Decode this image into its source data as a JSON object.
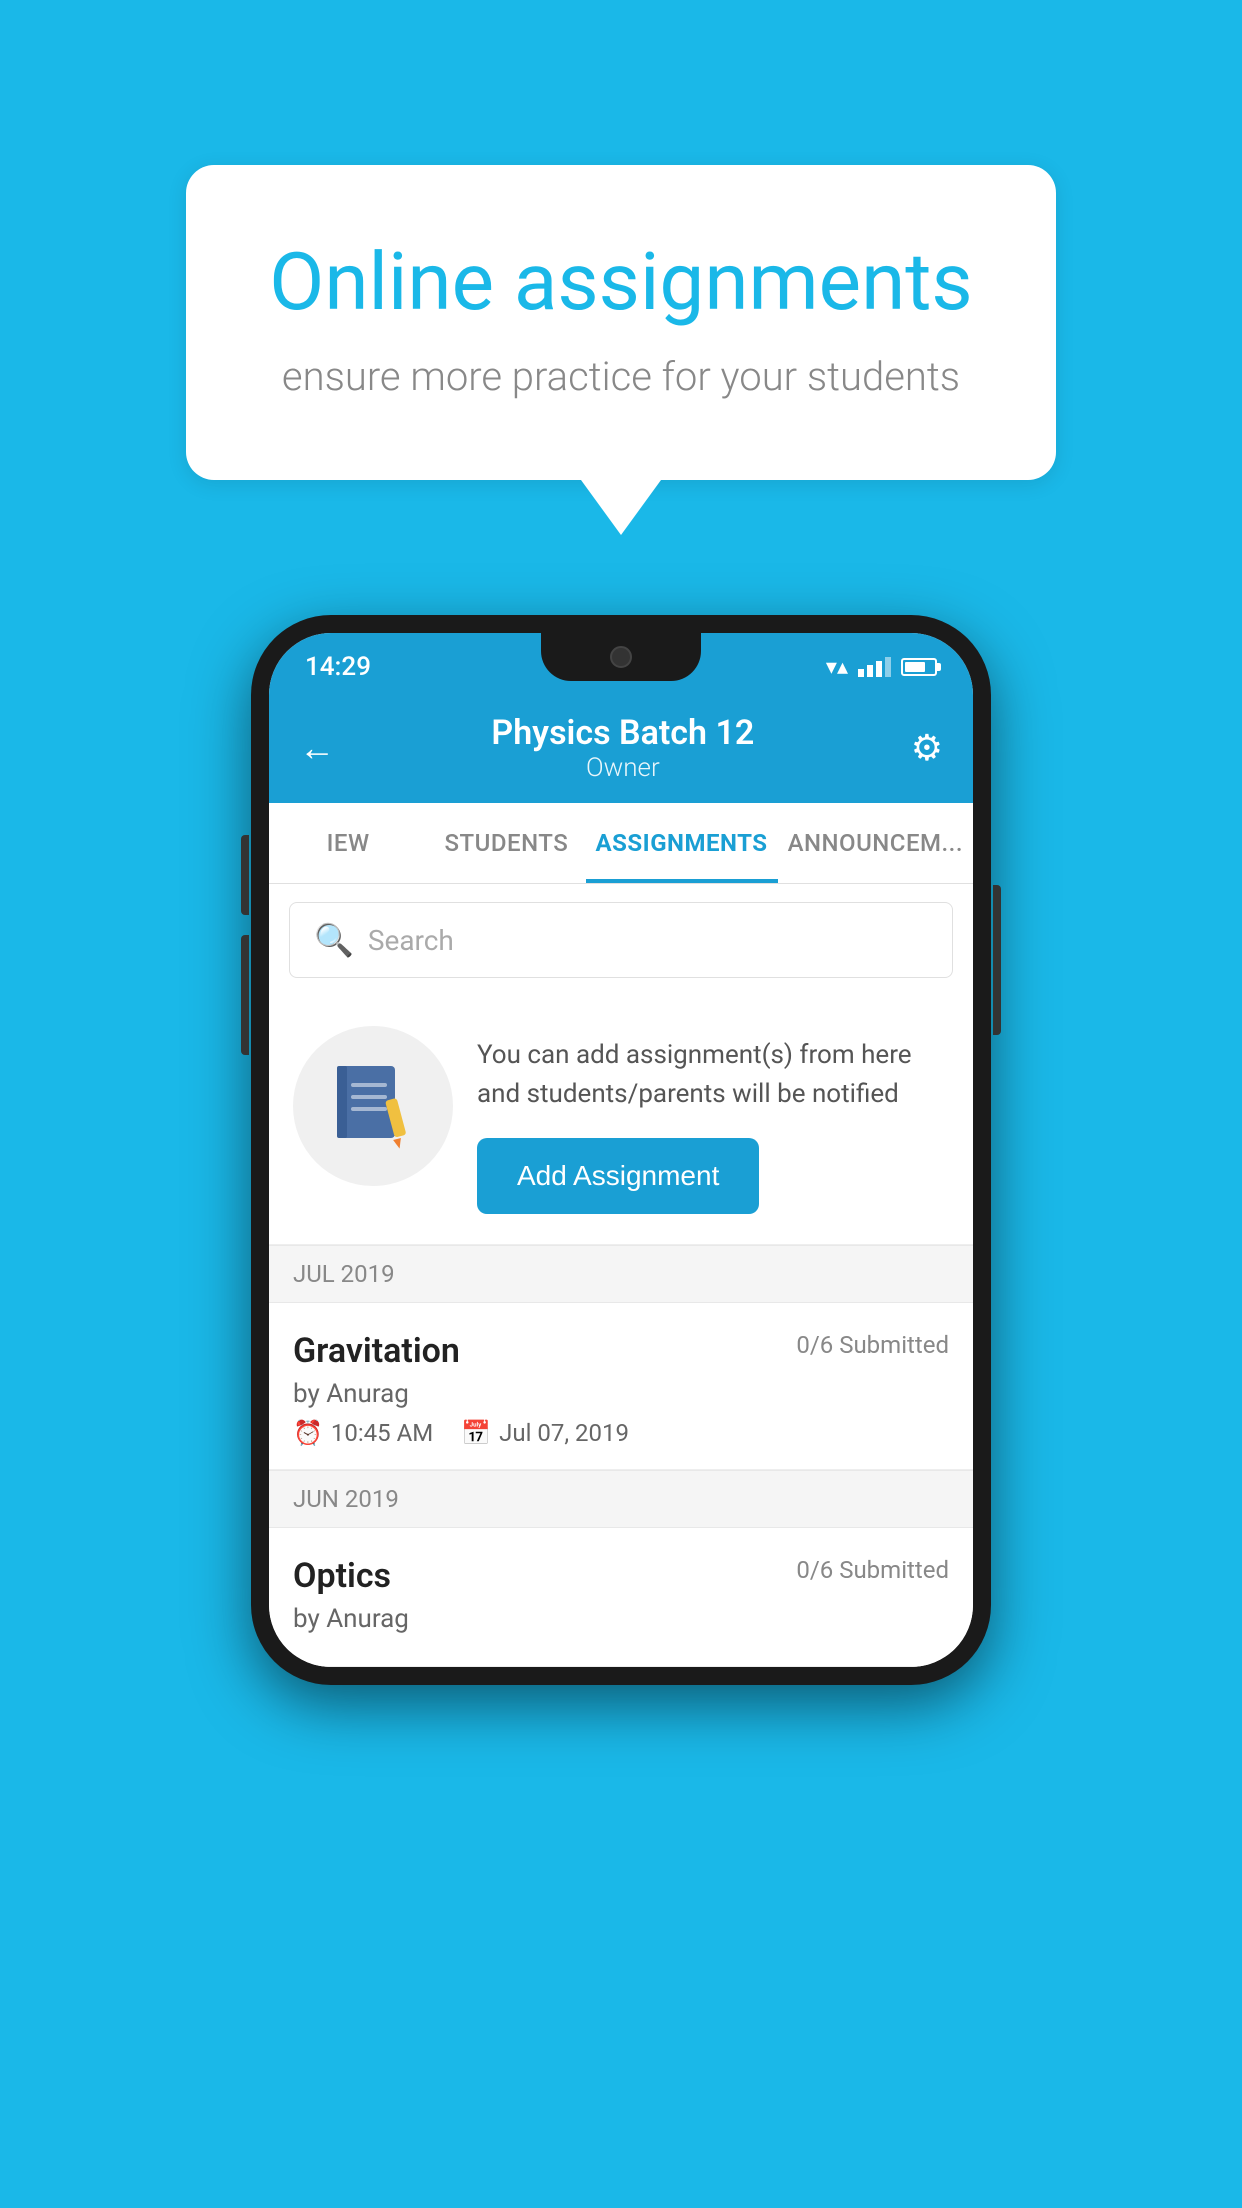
{
  "background_color": "#1ab8e8",
  "speech_bubble": {
    "title": "Online assignments",
    "subtitle": "ensure more practice for your students"
  },
  "phone": {
    "status_bar": {
      "time": "14:29"
    },
    "header": {
      "title": "Physics Batch 12",
      "subtitle": "Owner",
      "back_label": "←",
      "settings_label": "⚙"
    },
    "tabs": [
      {
        "label": "IEW",
        "active": false
      },
      {
        "label": "STUDENTS",
        "active": false
      },
      {
        "label": "ASSIGNMENTS",
        "active": true
      },
      {
        "label": "ANNOUNCEM...",
        "active": false
      }
    ],
    "search": {
      "placeholder": "Search"
    },
    "info_card": {
      "description": "You can add assignment(s) from here and students/parents will be notified",
      "add_button_label": "Add Assignment"
    },
    "sections": [
      {
        "label": "JUL 2019",
        "assignments": [
          {
            "name": "Gravitation",
            "submitted": "0/6 Submitted",
            "by": "by Anurag",
            "time": "10:45 AM",
            "date": "Jul 07, 2019"
          }
        ]
      },
      {
        "label": "JUN 2019",
        "assignments": [
          {
            "name": "Optics",
            "submitted": "0/6 Submitted",
            "by": "by Anurag",
            "time": "",
            "date": ""
          }
        ]
      }
    ]
  }
}
